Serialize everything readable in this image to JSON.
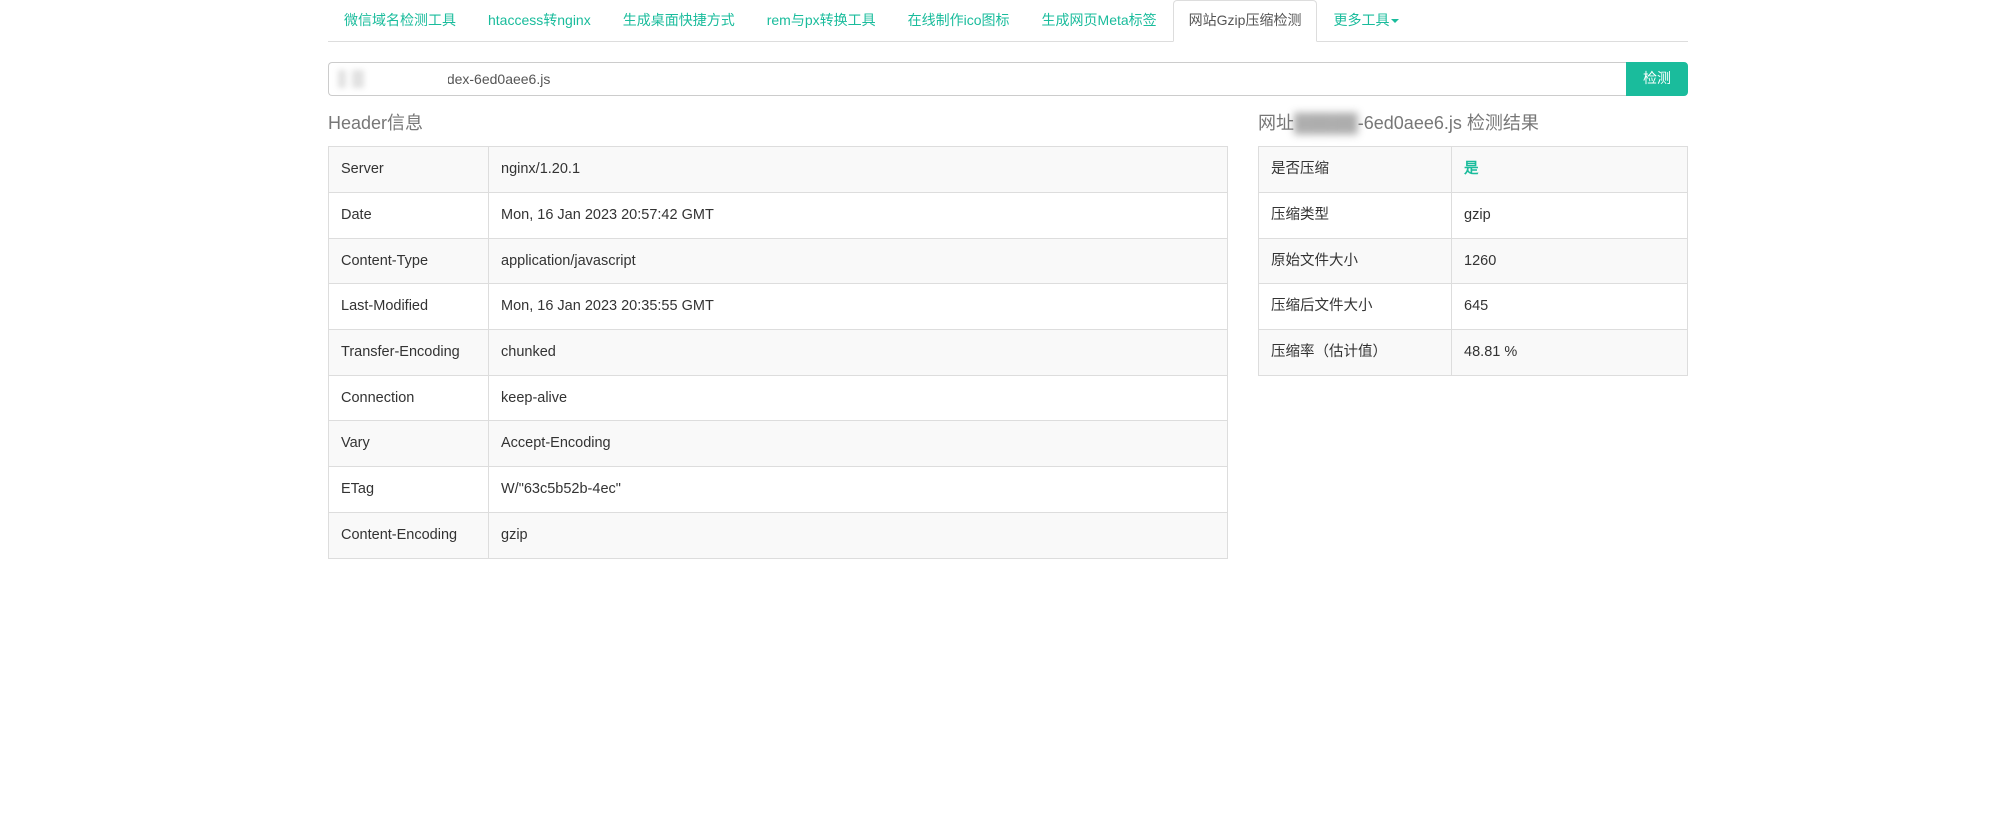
{
  "nav": {
    "tabs": [
      {
        "label": "微信域名检测工具",
        "active": false
      },
      {
        "label": "htaccess转nginx",
        "active": false
      },
      {
        "label": "生成桌面快捷方式",
        "active": false
      },
      {
        "label": "rem与px转换工具",
        "active": false
      },
      {
        "label": "在线制作ico图标",
        "active": false
      },
      {
        "label": "生成网页Meta标签",
        "active": false
      },
      {
        "label": "网站Gzip压缩检测",
        "active": true
      },
      {
        "label": "更多工具",
        "active": false,
        "dropdown": true
      }
    ]
  },
  "form": {
    "url_value": "            /assets/index-6ed0aee6.js",
    "submit_label": "检测"
  },
  "left": {
    "title": "Header信息",
    "headers": [
      {
        "key": "Server",
        "value": "nginx/1.20.1"
      },
      {
        "key": "Date",
        "value": "Mon, 16 Jan 2023 20:57:42 GMT"
      },
      {
        "key": "Content-Type",
        "value": "application/javascript"
      },
      {
        "key": "Last-Modified",
        "value": "Mon, 16 Jan 2023 20:35:55 GMT"
      },
      {
        "key": "Transfer-Encoding",
        "value": "chunked"
      },
      {
        "key": "Connection",
        "value": "keep-alive"
      },
      {
        "key": "Vary",
        "value": "Accept-Encoding"
      },
      {
        "key": "ETag",
        "value": "W/\"63c5b52b-4ec\""
      },
      {
        "key": "Content-Encoding",
        "value": "gzip"
      }
    ]
  },
  "right": {
    "title_prefix": "网址",
    "title_masked": "█████",
    "title_suffix": "-6ed0aee6.js 检测结果",
    "rows": [
      {
        "label": "是否压缩",
        "value": "是",
        "green": true
      },
      {
        "label": "压缩类型",
        "value": "gzip"
      },
      {
        "label": "原始文件大小",
        "value": "1260"
      },
      {
        "label": "压缩后文件大小",
        "value": "645"
      },
      {
        "label": "压缩率（估计值）",
        "value": "48.81 %"
      }
    ]
  }
}
